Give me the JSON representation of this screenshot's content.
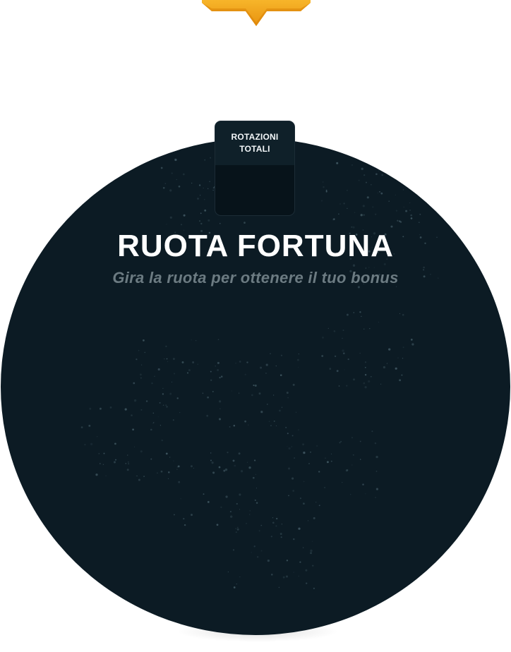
{
  "game": {
    "title": "RUOTA FORTUNA",
    "subtitle": "Gira la ruota per ottenere il tuo bonus"
  },
  "counter": {
    "label_line1": "ROTAZIONI",
    "label_line2": "TOTALI",
    "value": ""
  },
  "colors": {
    "wheel": "#0c1b24",
    "pointer": "#f2a319",
    "counter_header": "#0f2029",
    "counter_body": "#07131a",
    "subtitle": "#6c7b82"
  },
  "icons": {
    "pointer": "pointer-arrow-icon"
  }
}
